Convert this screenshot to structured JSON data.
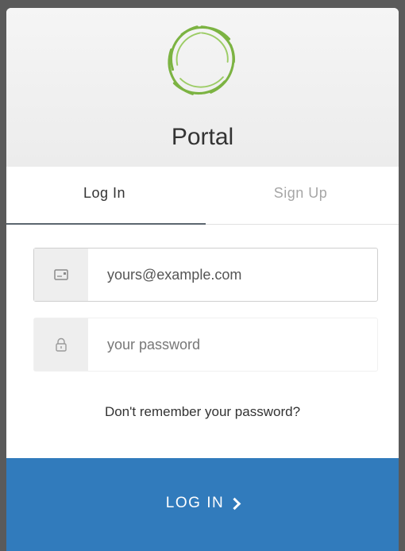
{
  "header": {
    "title": "Portal",
    "logo_icon": "portal-logo-icon",
    "logo_color": "#7cb342"
  },
  "tabs": [
    {
      "label": "Log In",
      "active": true
    },
    {
      "label": "Sign Up",
      "active": false
    }
  ],
  "form": {
    "email": {
      "placeholder": "yours@example.com",
      "value": "",
      "icon": "envelope-icon"
    },
    "password": {
      "placeholder": "your password",
      "value": "",
      "icon": "lock-icon"
    },
    "forgot_label": "Don't remember your password?"
  },
  "submit": {
    "label": "LOG IN",
    "icon": "chevron-right-icon",
    "color": "#317bbc"
  }
}
